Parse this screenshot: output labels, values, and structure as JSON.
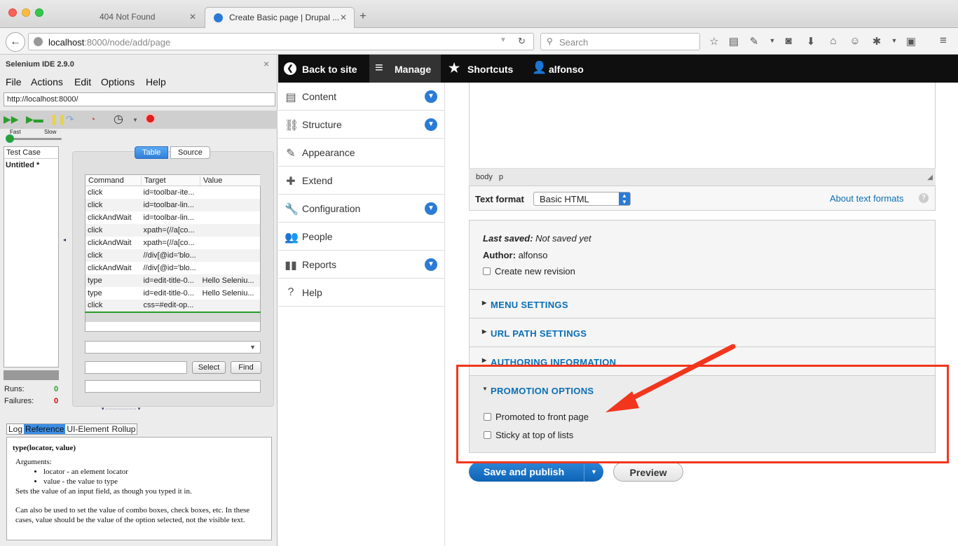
{
  "browser": {
    "tabs": [
      {
        "label": "404 Not Found"
      },
      {
        "label": "Create Basic page | Drupal ..."
      }
    ],
    "new_tab": "+",
    "url_host": "localhost",
    "url_rest": ":8000/node/add/page",
    "search_placeholder": "Search"
  },
  "selenium": {
    "title": "Selenium IDE 2.9.0",
    "close": "×",
    "menu": [
      "File",
      "Actions",
      "Edit",
      "Options",
      "Help"
    ],
    "base_url": "http://localhost:8000/",
    "speed_fast": "Fast",
    "speed_slow": "Slow",
    "testcase_header": "Test Case",
    "testcase_item": "Untitled *",
    "runs_label": "Runs:",
    "runs_value": "0",
    "failures_label": "Failures:",
    "failures_value": "0",
    "view_tabs": [
      "Table",
      "Source"
    ],
    "columns": [
      "Command",
      "Target",
      "Value"
    ],
    "rows": [
      {
        "command": "click",
        "target": "id=toolbar-ite...",
        "value": ""
      },
      {
        "command": "click",
        "target": "id=toolbar-lin...",
        "value": ""
      },
      {
        "command": "clickAndWait",
        "target": "id=toolbar-lin...",
        "value": ""
      },
      {
        "command": "click",
        "target": "xpath=(//a[co...",
        "value": ""
      },
      {
        "command": "clickAndWait",
        "target": "xpath=(//a[co...",
        "value": ""
      },
      {
        "command": "click",
        "target": "//div[@id='blo...",
        "value": ""
      },
      {
        "command": "clickAndWait",
        "target": "//div[@id='blo...",
        "value": ""
      },
      {
        "command": "type",
        "target": "id=edit-title-0...",
        "value": "Hello Seleniu..."
      },
      {
        "command": "type",
        "target": "id=edit-title-0...",
        "value": "Hello Seleniu..."
      },
      {
        "command": "click",
        "target": "css=#edit-op...",
        "value": ""
      }
    ],
    "select_button": "Select",
    "find_button": "Find",
    "bottom_tabs": [
      "Log",
      "Reference",
      "UI-Element",
      "Rollup"
    ],
    "ref": {
      "signature": "type(locator, value)",
      "arguments_label": "Arguments:",
      "args": [
        "locator - an element locator",
        "value - the value to type"
      ],
      "desc1": "Sets the value of an input field, as though you typed it in.",
      "desc2": "Can also be used to set the value of combo boxes, check boxes, etc. In these cases, value should be the value of the option selected, not the visible text."
    }
  },
  "drupal": {
    "toolbar": {
      "back": "Back to site",
      "manage": "Manage",
      "shortcuts": "Shortcuts",
      "user": "alfonso"
    },
    "menu": [
      {
        "label": "Content",
        "icon": "content-icon",
        "expand": true
      },
      {
        "label": "Structure",
        "icon": "structure-icon",
        "expand": true
      },
      {
        "label": "Appearance",
        "icon": "appearance-icon",
        "expand": false
      },
      {
        "label": "Extend",
        "icon": "extend-icon",
        "expand": false
      },
      {
        "label": "Configuration",
        "icon": "wrench-icon",
        "expand": true
      },
      {
        "label": "People",
        "icon": "people-icon",
        "expand": false
      },
      {
        "label": "Reports",
        "icon": "reports-icon",
        "expand": true
      },
      {
        "label": "Help",
        "icon": "help-icon",
        "expand": false
      }
    ],
    "editor_path": [
      "body",
      "p"
    ],
    "text_format_label": "Text format",
    "text_format_value": "Basic HTML",
    "about_formats": "About text formats",
    "last_saved_label": "Last saved:",
    "last_saved_value": "Not saved yet",
    "author_label": "Author:",
    "author_value": "alfonso",
    "new_revision": "Create new revision",
    "sections": [
      "MENU SETTINGS",
      "URL PATH SETTINGS",
      "AUTHORING INFORMATION",
      "PROMOTION OPTIONS"
    ],
    "promoted": "Promoted to front page",
    "sticky": "Sticky at top of lists",
    "save_button": "Save and publish",
    "preview_button": "Preview"
  },
  "colors": {
    "link_blue": "#0a6fb4",
    "accent_blue": "#2a7bd6",
    "annotation_red": "#f2361d"
  }
}
